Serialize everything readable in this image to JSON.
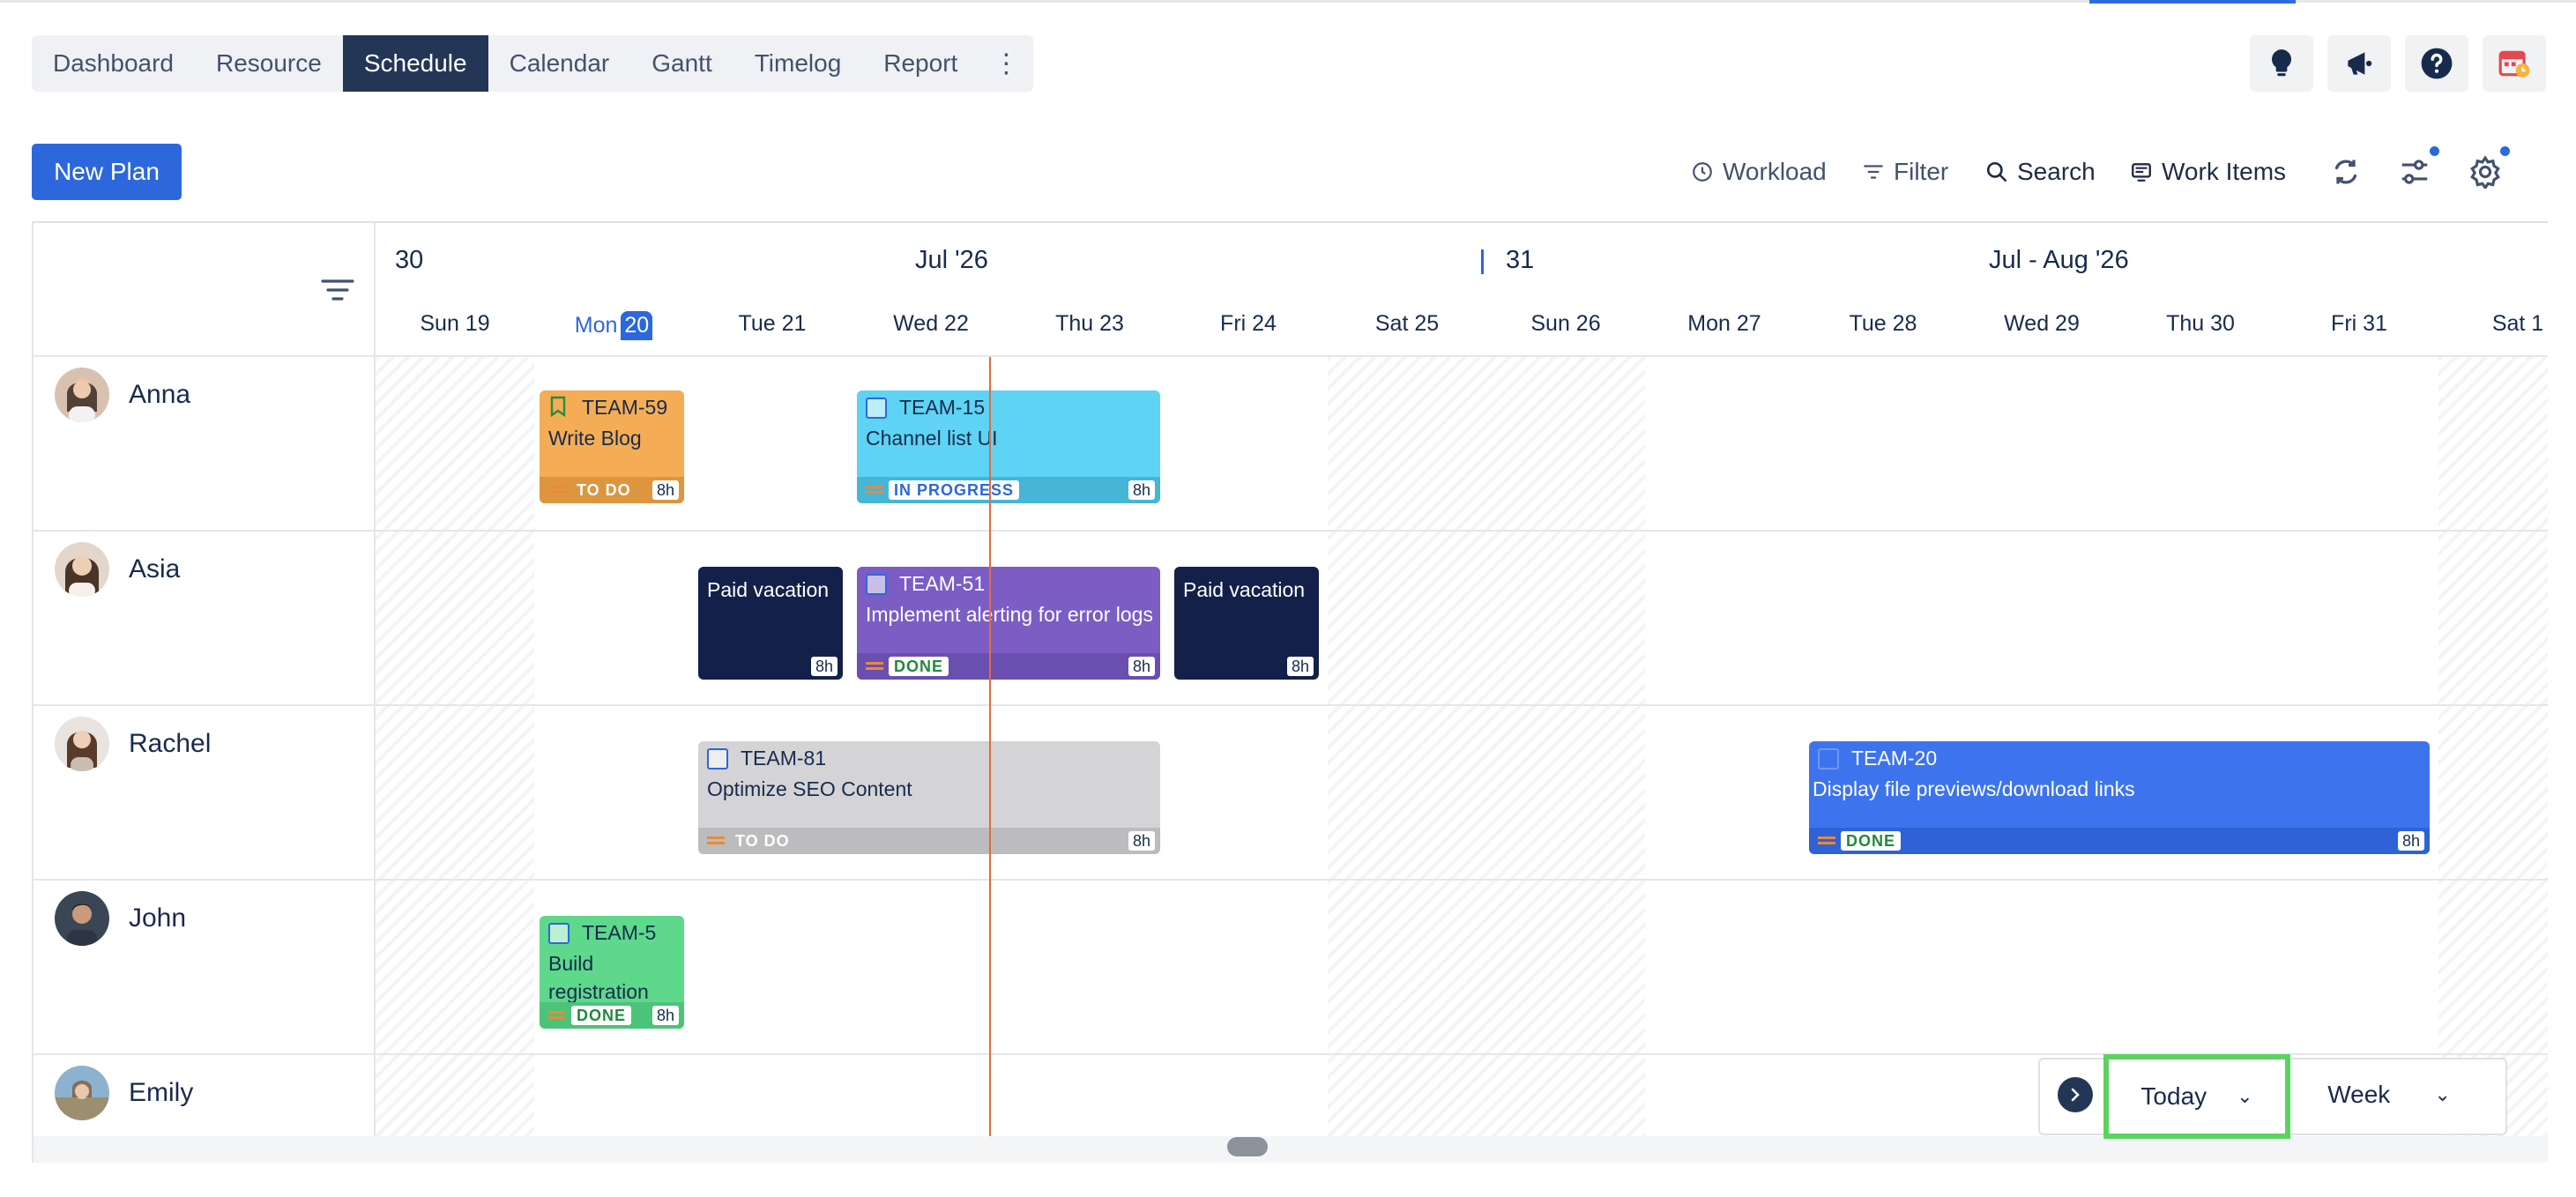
{
  "tabs": [
    "Dashboard",
    "Resource",
    "Schedule",
    "Calendar",
    "Gantt",
    "Timelog",
    "Report"
  ],
  "active_tab": "Schedule",
  "top_icons": [
    "lightbulb-icon",
    "megaphone-icon",
    "help-icon",
    "calendar-clock-icon"
  ],
  "new_plan_label": "New Plan",
  "toolbar": {
    "workload": "Workload",
    "filter": "Filter",
    "search": "Search",
    "work_items": "Work Items"
  },
  "header": {
    "week1_num": "30",
    "week1_label": "Jul '26",
    "week2_num": "31",
    "week2_label": "Jul - Aug '26",
    "days": [
      "Sun 19",
      "Mon",
      "Tue 21",
      "Wed 22",
      "Thu 23",
      "Fri 24",
      "Sat 25",
      "Sun 26",
      "Mon 27",
      "Tue 28",
      "Wed 29",
      "Thu 30",
      "Fri 31",
      "Sat 1"
    ],
    "today_num": "20"
  },
  "people": [
    "Anna",
    "Asia",
    "Rachel",
    "John",
    "Emily"
  ],
  "cards": {
    "team59": {
      "key": "TEAM-59",
      "title": "Write Blog",
      "status": "TO DO",
      "hours": "8h"
    },
    "team15": {
      "key": "TEAM-15",
      "title": "Channel list UI",
      "status": "IN PROGRESS",
      "hours": "8h"
    },
    "vac1": {
      "title": "Paid vacation",
      "hours": "8h"
    },
    "team51": {
      "key": "TEAM-51",
      "title": "Implement alerting for error logs",
      "status": "DONE",
      "hours": "8h"
    },
    "vac2": {
      "title": "Paid vacation",
      "hours": "8h"
    },
    "team81": {
      "key": "TEAM-81",
      "title": "Optimize SEO Content",
      "status": "TO DO",
      "hours": "8h"
    },
    "team20": {
      "key": "TEAM-20",
      "title": "Display file previews/download links",
      "status": "DONE",
      "hours": "8h"
    },
    "team5": {
      "key": "TEAM-5",
      "title": "Build registration",
      "status": "DONE",
      "hours": "8h"
    }
  },
  "nav": {
    "today_label": "Today",
    "view_label": "Week"
  },
  "colors": {
    "accent": "#2c67dc",
    "active_tab": "#243656",
    "today_line": "#e26b3d",
    "highlight": "#5bd35f"
  }
}
